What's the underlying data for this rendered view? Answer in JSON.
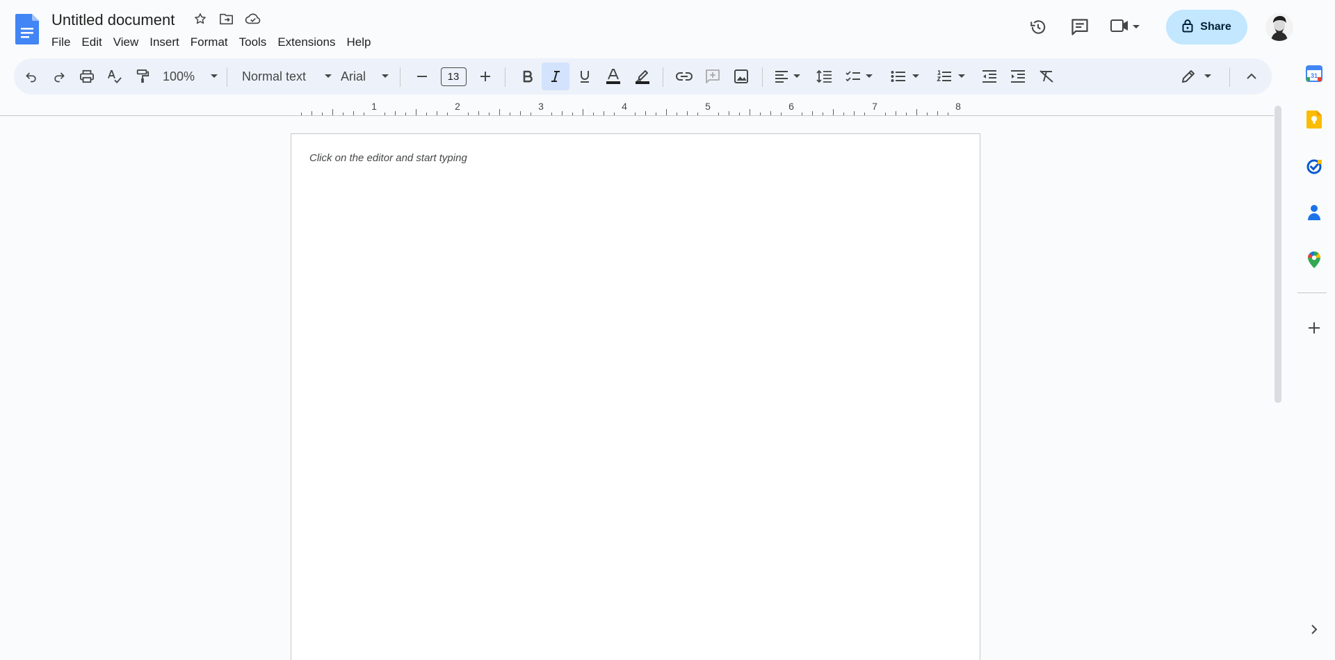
{
  "app": {
    "name": "Google Docs"
  },
  "document": {
    "title": "Untitled document"
  },
  "menu": [
    "File",
    "Edit",
    "View",
    "Insert",
    "Format",
    "Tools",
    "Extensions",
    "Help"
  ],
  "header": {
    "share_label": "Share"
  },
  "toolbar": {
    "zoom": "100%",
    "style": "Normal text",
    "font": "Arial",
    "font_size": "13",
    "active_format": "italic"
  },
  "ruler": {
    "marks": [
      "1",
      "2",
      "3",
      "4",
      "5",
      "6",
      "7",
      "8"
    ]
  },
  "editor": {
    "placeholder": "Click on the editor and start typing"
  },
  "colors": {
    "accent": "#0b57d0",
    "share_bg": "#c2e7ff",
    "toolbar_bg": "#edf2fa",
    "page_bg": "#f9fbfd"
  },
  "side_panel": [
    "calendar-icon",
    "keep-icon",
    "tasks-icon",
    "contacts-icon",
    "maps-icon",
    "add-icon"
  ]
}
